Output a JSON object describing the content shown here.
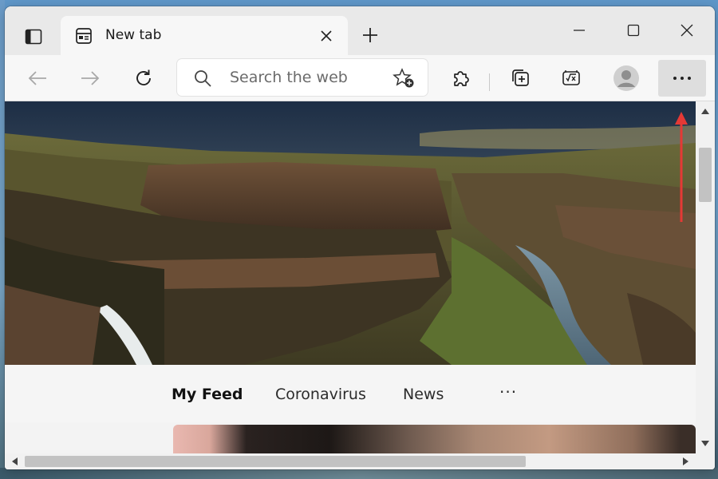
{
  "browser": {
    "tab": {
      "title": "New tab"
    },
    "address": {
      "placeholder": "Search the web"
    },
    "icons": {
      "tab_actions": "tab-actions-icon",
      "new_tab": "plus-icon",
      "back": "arrow-left-icon",
      "forward": "arrow-right-icon",
      "refresh": "refresh-icon",
      "search": "search-icon",
      "favorite": "star-plus-icon",
      "extensions": "puzzle-icon",
      "collections": "collections-icon",
      "math": "math-solver-icon",
      "profile": "avatar-icon",
      "more": "more-icon"
    }
  },
  "feed": {
    "tabs": [
      "My Feed",
      "Coronavirus",
      "News"
    ],
    "more_label": "···"
  },
  "colors": {
    "annotation_arrow": "#e53935",
    "tabstrip": "#e9e9e9",
    "toolbar": "#f7f7f7"
  }
}
